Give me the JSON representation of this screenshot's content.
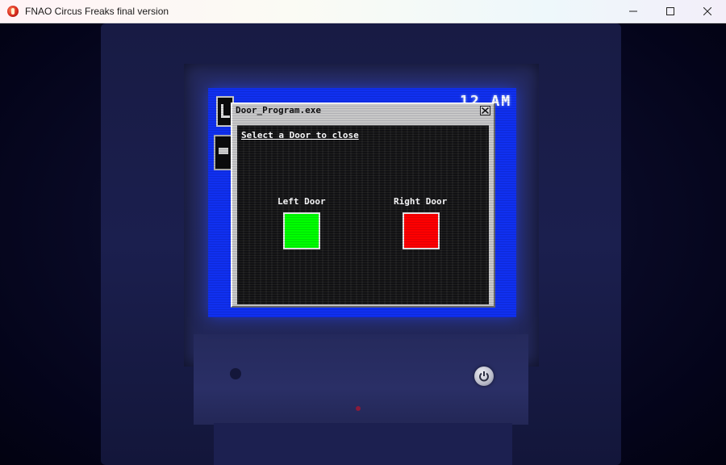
{
  "window": {
    "title": "FNAO Circus Freaks final version",
    "controls": [
      "minimize-icon",
      "maximize-icon",
      "close-icon"
    ]
  },
  "screen": {
    "clock": "12 AM",
    "desktop_icons": [
      "program-icon",
      "folder-icon"
    ]
  },
  "door_program": {
    "title": "Door_Program.exe",
    "prompt": "Select a Door to close",
    "left_door": {
      "label": "Left Door",
      "color": "#00ff00"
    },
    "right_door": {
      "label": "Right Door",
      "color": "#ff0000"
    }
  },
  "monitor": {
    "power_icon": "power-icon"
  }
}
